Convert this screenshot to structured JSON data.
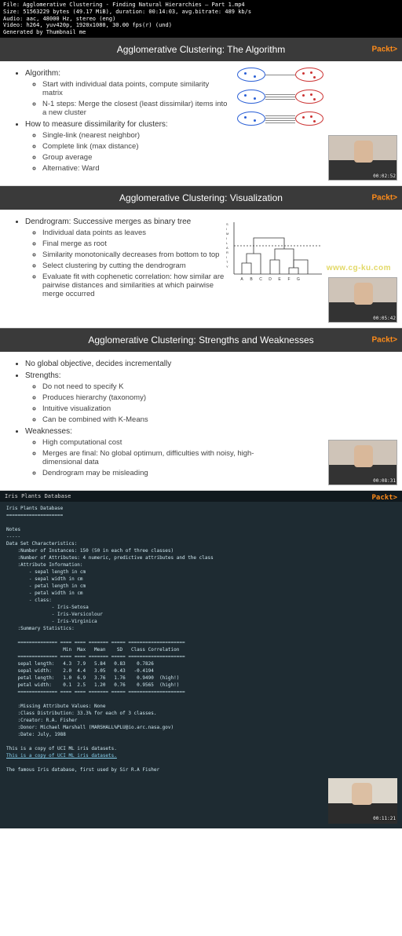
{
  "meta": {
    "file": "File: Agglomerative Clustering - Finding Natural Hierarchies – Part 1.mp4",
    "size": "Size: 51563229 bytes (49.17 MiB), duration: 00:14:03, avg.bitrate: 489 kb/s",
    "audio": "Audio: aac, 48000 Hz, stereo (eng)",
    "video": "Video: h264, yuv420p, 1920x1080, 30.00 fps(r) (und)",
    "gen": "Generated by Thumbnail me"
  },
  "brand": "Packt>",
  "slide1": {
    "title": "Agglomerative Clustering: The Algorithm",
    "timestamp": "00:02:52",
    "b1": "Algorithm:",
    "b1s1": "Start with individual data points, compute similarity matrix",
    "b1s2": "N-1 steps: Merge the closest (least dissimilar) items into a new cluster",
    "b2": "How to measure dissimilarity for clusters:",
    "b2s1": "Single-link (nearest neighbor)",
    "b2s2": "Complete link (max distance)",
    "b2s3": "Group average",
    "b2s4": "Alternative: Ward"
  },
  "slide2": {
    "title": "Agglomerative Clustering: Visualization",
    "timestamp": "00:05:42",
    "b1": "Dendrogram: Successive merges as binary tree",
    "b1s1": "Individual data points as leaves",
    "b1s2": "Final merge as root",
    "b1s3": "Similarity monotonically decreases from bottom to top",
    "b1s4": "Select clustering by cutting the dendrogram",
    "b1s5": "Evaluate fit with cophenetic correlation: how similar are pairwise distances and similarities at which pairwise merge occurred",
    "dendro_labels": [
      "A",
      "B",
      "C",
      "D",
      "E",
      "F",
      "G"
    ],
    "ylabel": "SIMILARITY"
  },
  "watermark": "www.cg-ku.com",
  "slide3": {
    "title": "Agglomerative Clustering: Strengths and Weaknesses",
    "timestamp": "00:08:31",
    "b1": "No global objective, decides incrementally",
    "b2": "Strengths:",
    "b2s1": "Do not need to specify K",
    "b2s2": "Produces hierarchy (taxonomy)",
    "b2s3": "Intuitive visualization",
    "b2s4": "Can be combined with K-Means",
    "b3": "Weaknesses:",
    "b3s1": "High computational cost",
    "b3s2": "Merges are final: No global optimum, difficulties with noisy, high-dimensional data",
    "b3s3": "Dendrogram may be misleading"
  },
  "slide4": {
    "title": "Iris Plants Database",
    "timestamp": "00:11:21",
    "code": "Iris Plants Database\n====================\n\nNotes\n-----\nData Set Characteristics:\n    :Number of Instances: 150 (50 in each of three classes)\n    :Number of Attributes: 4 numeric, predictive attributes and the class\n    :Attribute Information:\n        - sepal length in cm\n        - sepal width in cm\n        - petal length in cm\n        - petal width in cm\n        - class:\n                - Iris-Setosa\n                - Iris-Versicolour\n                - Iris-Virginica\n    :Summary Statistics:\n\n    ============== ==== ==== ======= ===== ====================\n                    Min  Max   Mean    SD   Class Correlation\n    ============== ==== ==== ======= ===== ====================\n    sepal length:   4.3  7.9   5.84   0.83    0.7826\n    sepal width:    2.0  4.4   3.05   0.43   -0.4194\n    petal length:   1.0  6.9   3.76   1.76    0.9490  (high!)\n    petal width:    0.1  2.5   1.20   0.76    0.9565  (high!)\n    ============== ==== ==== ======= ===== ====================\n\n    :Missing Attribute Values: None\n    :Class Distribution: 33.3% for each of 3 classes.\n    :Creator: R.A. Fisher\n    :Donor: Michael Marshall (MARSHALL%PLU@io.arc.nasa.gov)\n    :Date: July, 1988\n\nThis is a copy of UCI ML iris datasets.",
    "footer": "The famous Iris database, first used by Sir R.A Fisher"
  }
}
